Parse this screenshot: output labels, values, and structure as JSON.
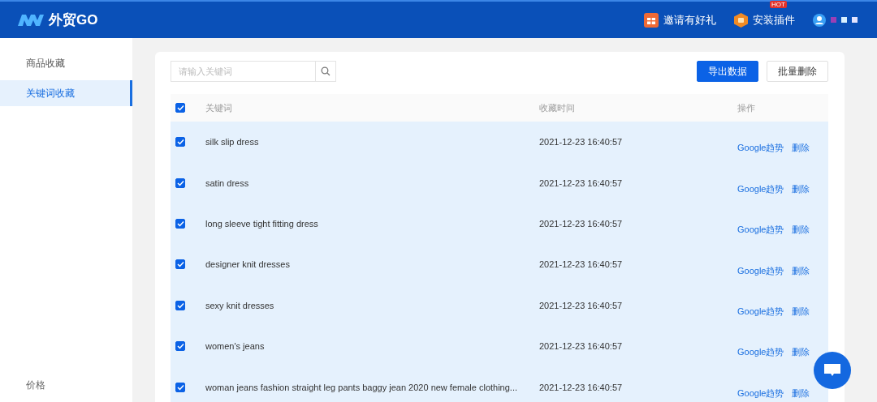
{
  "header": {
    "logo": "外贸GO",
    "links": [
      {
        "label": "邀请有好礼",
        "kind": "gift"
      },
      {
        "label": "安装插件",
        "kind": "plugin",
        "badge": "HOT"
      }
    ],
    "dots": [
      {
        "color": "#9b3fb5"
      },
      {
        "color": "#d8f0ff"
      },
      {
        "color": "#e4e4ff"
      }
    ]
  },
  "sidebar": {
    "items": [
      {
        "label": "商品收藏",
        "selected": false
      },
      {
        "label": "关键词收藏",
        "selected": true
      }
    ],
    "footer": "价格"
  },
  "toolbar": {
    "search": {
      "placeholder": "请输入关键词"
    },
    "buttons": [
      {
        "label": "导出数据",
        "kind": "primary"
      },
      {
        "label": "批量删除",
        "kind": "default"
      }
    ]
  },
  "table": {
    "columns": [
      "关键词",
      "收藏时间",
      "操作"
    ],
    "all_checked": true,
    "rows": [
      {
        "keyword": "silk slip dress",
        "time": "2021-12-23 16:40:57",
        "checked": true,
        "actions": [
          "Google趋势",
          "删除"
        ]
      },
      {
        "keyword": "satin dress",
        "time": "2021-12-23 16:40:57",
        "checked": true,
        "actions": [
          "Google趋势",
          "删除"
        ]
      },
      {
        "keyword": "long sleeve tight fitting dress",
        "time": "2021-12-23 16:40:57",
        "checked": true,
        "actions": [
          "Google趋势",
          "删除"
        ]
      },
      {
        "keyword": "designer knit dresses",
        "time": "2021-12-23 16:40:57",
        "checked": true,
        "actions": [
          "Google趋势",
          "删除"
        ]
      },
      {
        "keyword": "sexy knit dresses",
        "time": "2021-12-23 16:40:57",
        "checked": true,
        "actions": [
          "Google趋势",
          "删除"
        ]
      },
      {
        "keyword": "women's jeans",
        "time": "2021-12-23 16:40:57",
        "checked": true,
        "actions": [
          "Google趋势",
          "删除"
        ]
      },
      {
        "keyword": "woman jeans fashion straight leg pants baggy jean 2020 new female clothing...",
        "time": "2021-12-23 16:40:57",
        "checked": true,
        "actions": [
          "Google趋势",
          "删除"
        ]
      }
    ]
  }
}
